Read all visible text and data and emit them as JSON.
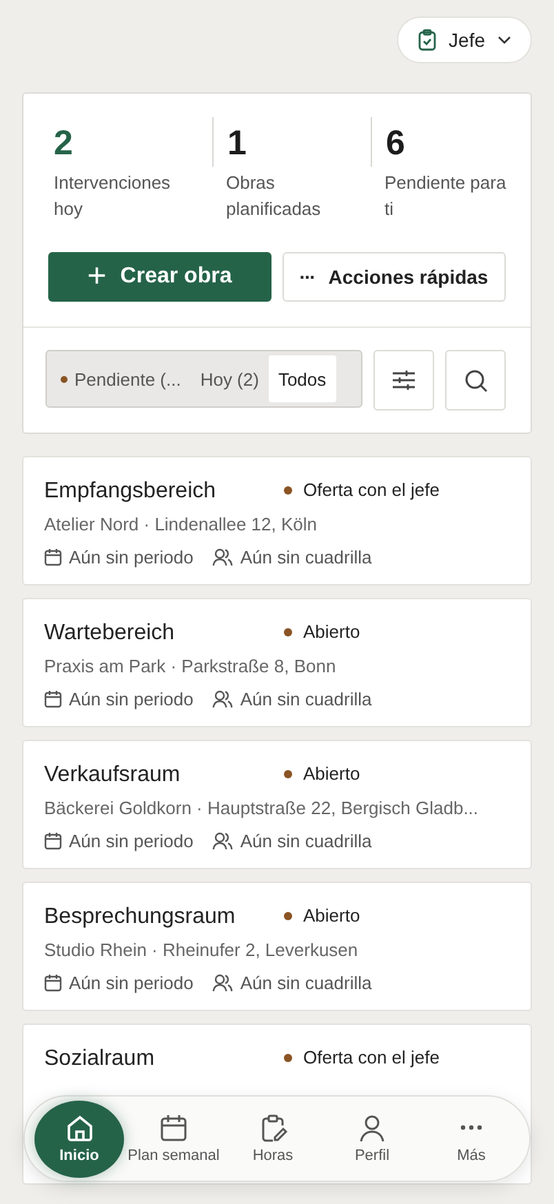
{
  "role_menu": {
    "label": "Jefe"
  },
  "summary": {
    "stats": [
      {
        "value": "2",
        "label": "Intervenciones hoy",
        "highlight": true
      },
      {
        "value": "1",
        "label": "Obras planificadas",
        "highlight": false
      },
      {
        "value": "6",
        "label": "Pendiente para ti",
        "highlight": false
      }
    ],
    "primary_action": {
      "icon": "+",
      "label": "Crear obra"
    },
    "secondary_action": {
      "icon": "···",
      "label": "Acciones rápidas"
    },
    "filters": [
      {
        "label": "Pendiente (...",
        "selected": false,
        "color": "#8a5424"
      },
      {
        "label": "Hoy (2)",
        "selected": false
      },
      {
        "label": "Todos",
        "selected": true
      }
    ]
  },
  "jobs": [
    {
      "title": "Empfangsbereich",
      "status": "Oferta con el jefe",
      "color": "#8a5424",
      "subtitle": "Atelier Nord · Lindenallee 12, Köln",
      "period": "Aún sin periodo",
      "crew": "Aún sin cuadrilla"
    },
    {
      "title": "Wartebereich",
      "status": "Abierto",
      "color": "#8a5424",
      "subtitle": "Praxis am Park · Parkstraße 8, Bonn",
      "period": "Aún sin periodo",
      "crew": "Aún sin cuadrilla"
    },
    {
      "title": "Verkaufsraum",
      "status": "Abierto",
      "color": "#8a5424",
      "subtitle": "Bäckerei Goldkorn · Hauptstraße 22, Bergisch Gladb...",
      "period": "Aún sin periodo",
      "crew": "Aún sin cuadrilla"
    },
    {
      "title": "Besprechungsraum",
      "status": "Abierto",
      "color": "#8a5424",
      "subtitle": "Studio Rhein · Rheinufer 2, Leverkusen",
      "period": "Aún sin periodo",
      "crew": "Aún sin cuadrilla"
    },
    {
      "title": "Sozialraum",
      "status": "Oferta con el jefe",
      "color": "#8a5424"
    }
  ],
  "bottom_nav": [
    {
      "kind": "home",
      "label": "Inicio",
      "selected": true
    },
    {
      "kind": "calendar",
      "label": "Plan semanal",
      "selected": false
    },
    {
      "kind": "clipboard",
      "label": "Horas",
      "selected": false
    },
    {
      "kind": "person",
      "label": "Perfil",
      "selected": false
    },
    {
      "kind": "dots",
      "label": "Más",
      "selected": false
    }
  ]
}
